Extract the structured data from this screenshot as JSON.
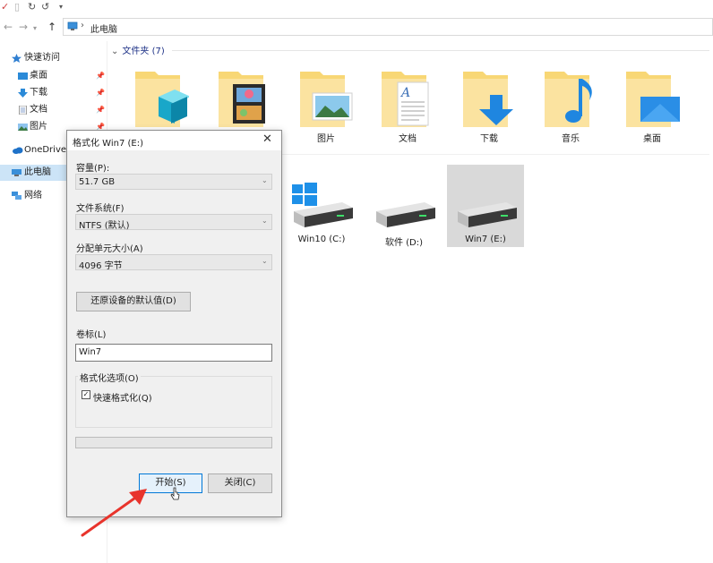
{
  "explorer": {
    "breadcrumb": "此电脑",
    "folders_header": "文件夹 (7)",
    "folders": [
      {
        "label": "",
        "icon": "3d-objects-folder-icon"
      },
      {
        "label": "",
        "icon": "videos-folder-icon"
      },
      {
        "label": "图片",
        "icon": "pictures-folder-icon"
      },
      {
        "label": "文档",
        "icon": "documents-folder-icon"
      },
      {
        "label": "下载",
        "icon": "downloads-folder-icon"
      },
      {
        "label": "音乐",
        "icon": "music-folder-icon"
      },
      {
        "label": "桌面",
        "icon": "desktop-folder-icon"
      }
    ],
    "drives": [
      {
        "label": "Win10 (C:)",
        "icon": "windows-drive-icon"
      },
      {
        "label": "软件 (D:)",
        "icon": "hard-drive-icon"
      },
      {
        "label": "Win7 (E:)",
        "icon": "hard-drive-icon",
        "selected": true
      }
    ]
  },
  "sidebar": {
    "items": [
      {
        "label": "快速访问",
        "icon": "star-icon"
      },
      {
        "label": "桌面",
        "icon": "desktop-icon",
        "pinned": true
      },
      {
        "label": "下载",
        "icon": "download-icon",
        "pinned": true
      },
      {
        "label": "文档",
        "icon": "document-icon",
        "pinned": true
      },
      {
        "label": "图片",
        "icon": "picture-icon",
        "pinned": true
      },
      {
        "label": "OneDrive",
        "icon": "cloud-icon"
      },
      {
        "label": "此电脑",
        "icon": "computer-icon",
        "selected": true
      },
      {
        "label": "网络",
        "icon": "network-icon"
      }
    ]
  },
  "dialog": {
    "title": "格式化 Win7 (E:)",
    "capacity_label": "容量(P):",
    "capacity_value": "51.7 GB",
    "filesystem_label": "文件系统(F)",
    "filesystem_value": "NTFS (默认)",
    "allocation_label": "分配单元大小(A)",
    "allocation_value": "4096 字节",
    "restore_defaults_label": "还原设备的默认值(D)",
    "volume_label_label": "卷标(L)",
    "volume_label_value": "Win7",
    "format_options_label": "格式化选项(O)",
    "quick_format_label": "快速格式化(Q)",
    "quick_format_checked": true,
    "progress": 0,
    "start_label": "开始(S)",
    "close_label": "关闭(C)"
  },
  "colors": {
    "accent": "#0078d7",
    "folder_yellow": "#f8d775",
    "annotation_arrow": "#e8342c",
    "selection": "#cce4f7"
  }
}
